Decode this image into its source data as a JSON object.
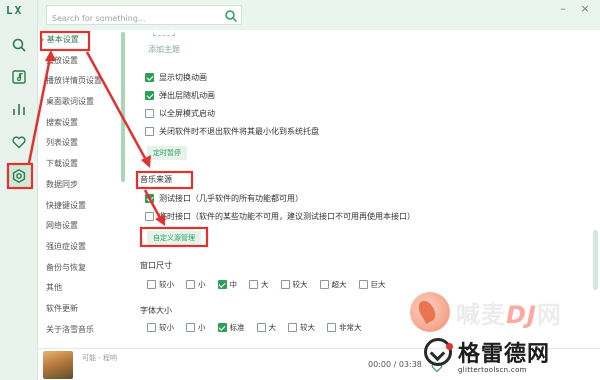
{
  "app": {
    "logo": "LX"
  },
  "search": {
    "placeholder": "Search for something..."
  },
  "settings_nav": {
    "items": [
      "基本设置",
      "播放设置",
      "播放详情页设置",
      "桌面歌词设置",
      "搜索设置",
      "列表设置",
      "下载设置",
      "数据同步",
      "快捷键设置",
      "网络设置",
      "强迫症设置",
      "备份与恢复",
      "其他",
      "软件更新",
      "关于洛雪音乐"
    ],
    "active_index": 0
  },
  "content": {
    "add_theme": "添加主题",
    "toggles": [
      {
        "label": "显示切换动画",
        "checked": true
      },
      {
        "label": "弹出层随机动画",
        "checked": true
      },
      {
        "label": "以全屏模式启动",
        "checked": false
      },
      {
        "label": "关闭软件时不退出软件将其最小化到系统托盘",
        "checked": false
      }
    ],
    "timer_button": "定时暂停",
    "music_source": {
      "title": "音乐来源",
      "options": [
        {
          "label": "测试接口（几乎软件的所有功能都可用）",
          "checked": true
        },
        {
          "label": "临时接口（软件的某些功能不可用，建议测试接口不可用再使用本接口）",
          "checked": false
        }
      ],
      "custom_button": "自定义源管理"
    },
    "window_size": {
      "title": "窗口尺寸",
      "options": [
        {
          "label": "较小",
          "checked": false
        },
        {
          "label": "小",
          "checked": false
        },
        {
          "label": "中",
          "checked": true
        },
        {
          "label": "大",
          "checked": false
        },
        {
          "label": "较大",
          "checked": false
        },
        {
          "label": "超大",
          "checked": false
        },
        {
          "label": "巨大",
          "checked": false
        }
      ]
    },
    "font_size": {
      "title": "字体大小",
      "options": [
        {
          "label": "较小",
          "checked": false
        },
        {
          "label": "小",
          "checked": false
        },
        {
          "label": "标准",
          "checked": true
        },
        {
          "label": "大",
          "checked": false
        },
        {
          "label": "较大",
          "checked": false
        },
        {
          "label": "非常大",
          "checked": false
        }
      ]
    }
  },
  "player": {
    "track": "可能 - 程响",
    "time": "00:00 / 03:38"
  },
  "watermark": {
    "line1": "喊麦",
    "line1_accent": "DJ",
    "line1_end": "网",
    "line2": "格雷德网",
    "line3": "glittertoolscn.com"
  },
  "colors": {
    "accent": "#2f9e5a",
    "annotation": "#e0322f",
    "rail_bg": "#e7f3ec"
  }
}
